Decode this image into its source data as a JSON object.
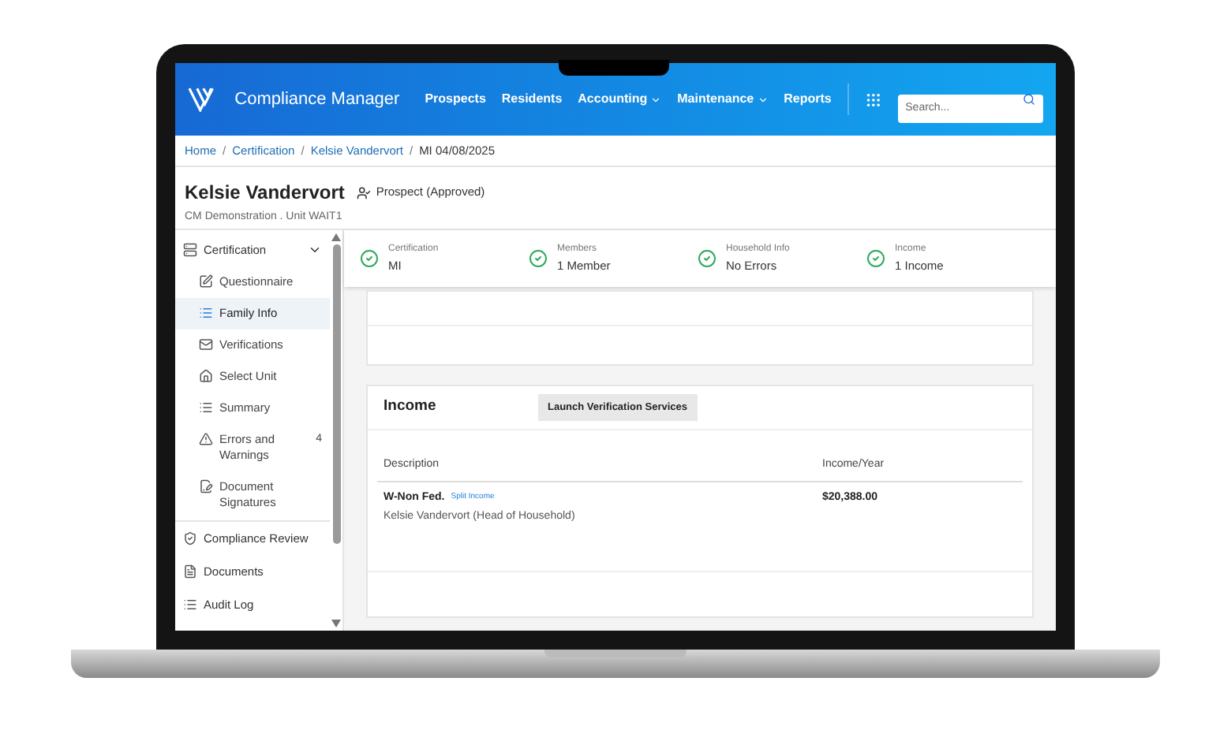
{
  "header": {
    "brand": "Compliance Manager",
    "nav": [
      {
        "label": "Prospects",
        "dropdown": false
      },
      {
        "label": "Residents",
        "dropdown": false
      },
      {
        "label": "Accounting",
        "dropdown": true
      },
      {
        "label": "Maintenance",
        "dropdown": true
      },
      {
        "label": "Reports",
        "dropdown": false
      }
    ],
    "search": {
      "placeholder": "Search..."
    }
  },
  "breadcrumb": {
    "separator": "/",
    "items": [
      {
        "label": "Home",
        "link": true
      },
      {
        "label": "Certification",
        "link": true
      },
      {
        "label": "Kelsie Vandervort",
        "link": true
      },
      {
        "label": "MI 04/08/2025",
        "link": false
      }
    ]
  },
  "person": {
    "name": "Kelsie Vandervort",
    "status": "Prospect (Approved)",
    "subtitle": "CM Demonstration . Unit WAIT1"
  },
  "sidebar": {
    "items": [
      {
        "label": "Certification",
        "expanded": true,
        "children": [
          {
            "label": "Questionnaire",
            "selected": false
          },
          {
            "label": "Family Info",
            "selected": true
          },
          {
            "label": "Verifications",
            "selected": false
          },
          {
            "label": "Select Unit",
            "selected": false
          },
          {
            "label": "Summary",
            "selected": false
          },
          {
            "label": "Errors and Warnings",
            "selected": false,
            "badge": "4"
          },
          {
            "label": "Document Signatures",
            "selected": false
          }
        ]
      },
      {
        "label": "Compliance Review"
      },
      {
        "label": "Documents"
      },
      {
        "label": "Audit Log"
      }
    ]
  },
  "steps": [
    {
      "label": "Certification",
      "value": "MI",
      "complete": true
    },
    {
      "label": "Members",
      "value": "1 Member",
      "complete": true
    },
    {
      "label": "Household Info",
      "value": "No Errors",
      "complete": true
    },
    {
      "label": "Income",
      "value": "1 Income",
      "complete": true
    }
  ],
  "income": {
    "title": "Income",
    "button": "Launch Verification Services",
    "columns": [
      "Description",
      "Income/Year"
    ],
    "rows": [
      {
        "type": "W-Non Fed.",
        "link": "Split Income",
        "member": "Kelsie Vandervort (Head of Household)",
        "amount": "$20,388.00"
      }
    ]
  }
}
